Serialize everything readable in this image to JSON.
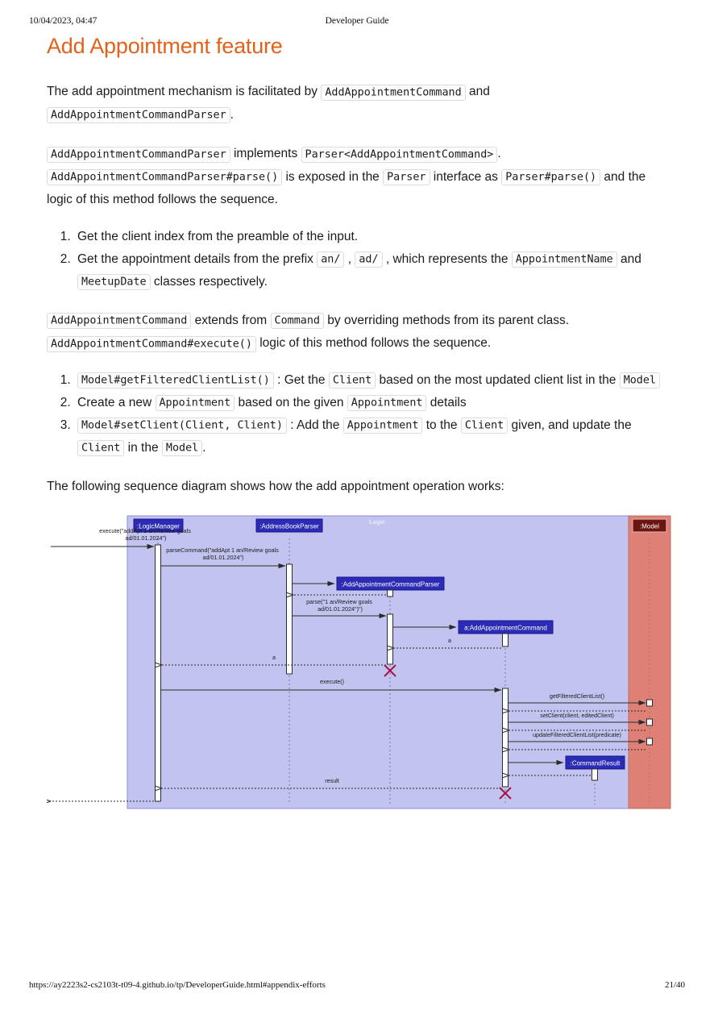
{
  "print_header": {
    "date": "10/04/2023, 04:47",
    "title": "Developer Guide"
  },
  "print_footer": {
    "url": "https://ay2223s2-cs2103t-t09-4.github.io/tp/DeveloperGuide.html#appendix-efforts",
    "page": "21/40"
  },
  "doc": {
    "title": "Add Appointment feature",
    "title_color": "#e2621b",
    "p1": {
      "t1": "The add appointment mechanism is facilitated by ",
      "c1": "AddAppointmentCommand",
      "t2": " and ",
      "c2": "AddAppointmentCommandParser",
      "t3": "."
    },
    "p2": {
      "c1": "AddAppointmentCommandParser",
      "t1": " implements ",
      "c2": "Parser<AddAppointmentCommand>",
      "t2": ". ",
      "c3": "AddAppointmentCommandParser#parse()",
      "t3": " is exposed in the ",
      "c4": "Parser",
      "t4": " interface as ",
      "c5": "Parser#parse()",
      "t5": " and the logic of this method follows the sequence."
    },
    "list1": {
      "item1": {
        "t1": "Get the client index from the preamble of the input."
      },
      "item2": {
        "t1": "Get the appointment details from the prefix ",
        "c1": "an/",
        "t2": " , ",
        "c2": "ad/",
        "t3": " , which represents the ",
        "c3": "AppointmentName",
        "t4": " and ",
        "c4": "MeetupDate",
        "t5": " classes respectively."
      }
    },
    "p3": {
      "c1": "AddAppointmentCommand",
      "t1": " extends from ",
      "c2": "Command",
      "t2": " by overriding methods from its parent class. ",
      "c3": "AddAppointmentCommand#execute()",
      "t3": " logic of this method follows the sequence."
    },
    "list2": {
      "item1": {
        "c1": "Model#getFilteredClientList()",
        "t1": " : Get the ",
        "c2": "Client",
        "t2": " based on the most updated client list in the ",
        "c3": "Model"
      },
      "item2": {
        "t1": "Create a new ",
        "c1": "Appointment",
        "t2": " based on the given ",
        "c2": "Appointment",
        "t3": " details"
      },
      "item3": {
        "c1": "Model#setClient(Client, Client)",
        "t1": " : Add the ",
        "c2": "Appointment",
        "t2": " to the ",
        "c3": "Client",
        "t3": " given, and update the ",
        "c4": "Client",
        "t4": " in the ",
        "c5": "Model",
        "t5": "."
      }
    },
    "p4": "The following sequence diagram shows how the add appointment operation works:"
  },
  "diagram": {
    "type": "uml-sequence",
    "colors": {
      "logic_panel_bg": "#c3c3f0",
      "logic_panel_border": "#8a8ad8",
      "model_panel_bg": "#df8077",
      "model_panel_border": "#c06a62",
      "participant_fill": "#2b2bb5",
      "participant_text": "#ffffff",
      "model_participant_fill": "#6b1410",
      "model_participant_border": "#d8a6a0",
      "activation_fill": "#ffffff",
      "activation_border": "#2b2b2b",
      "line": "#2b2b2b",
      "destroy_x": "#a01848",
      "group_label": "#f0f0f6"
    },
    "groups": [
      {
        "label": "Logic",
        "kind": "logic"
      },
      {
        "label": "Model",
        "kind": "model"
      }
    ],
    "participants": [
      {
        "id": "lm",
        "label": ":LogicManager",
        "group": "logic"
      },
      {
        "id": "abp",
        "label": ":AddressBookParser",
        "group": "logic"
      },
      {
        "id": "aacp",
        "label": ":AddAppointmentCommandParser",
        "group": "logic"
      },
      {
        "id": "aac",
        "label": "a:AddAppointmentCommand",
        "group": "logic"
      },
      {
        "id": "cr",
        "label": ":CommandResult",
        "group": "logic"
      },
      {
        "id": "model",
        "label": ":Model",
        "group": "model"
      }
    ],
    "messages": [
      {
        "from": "actor",
        "to": "lm",
        "label": "execute(\"addApt 1 an/Review goals\nad/01.01.2024\")",
        "kind": "call"
      },
      {
        "from": "lm",
        "to": "abp",
        "label": "parseCommand(\"addApt 1 an/Review goals\nad/01.01.2024\")",
        "kind": "call"
      },
      {
        "from": "abp",
        "to": "aacp",
        "label": "",
        "kind": "create"
      },
      {
        "from": "aacp",
        "to": "abp",
        "label": "",
        "kind": "return"
      },
      {
        "from": "abp",
        "to": "aacp",
        "label": "parse(\"1 an/Review goals\nad/01.01.2024\")\")",
        "kind": "call"
      },
      {
        "from": "aacp",
        "to": "aac",
        "label": "",
        "kind": "create"
      },
      {
        "from": "aac",
        "to": "aacp",
        "label": "a",
        "kind": "return"
      },
      {
        "from": "aacp",
        "to": "lm",
        "label": "a",
        "kind": "return"
      },
      {
        "from": "destroy",
        "to": "aacp",
        "label": "",
        "kind": "destroy"
      },
      {
        "from": "lm",
        "to": "aac",
        "label": "execute()",
        "kind": "call"
      },
      {
        "from": "aac",
        "to": "model",
        "label": "getFilteredClientList()",
        "kind": "call"
      },
      {
        "from": "model",
        "to": "aac",
        "label": "",
        "kind": "return"
      },
      {
        "from": "aac",
        "to": "model",
        "label": "setClient(client, editedClient)",
        "kind": "call"
      },
      {
        "from": "model",
        "to": "aac",
        "label": "",
        "kind": "return"
      },
      {
        "from": "aac",
        "to": "model",
        "label": "updateFilteredClientList(predicate)",
        "kind": "call"
      },
      {
        "from": "model",
        "to": "aac",
        "label": "",
        "kind": "return"
      },
      {
        "from": "aac",
        "to": "cr",
        "label": "",
        "kind": "create"
      },
      {
        "from": "cr",
        "to": "aac",
        "label": "",
        "kind": "return"
      },
      {
        "from": "aac",
        "to": "lm",
        "label": "result",
        "kind": "return"
      },
      {
        "from": "destroy",
        "to": "aac",
        "label": "",
        "kind": "destroy"
      },
      {
        "from": "lm",
        "to": "actor",
        "label": "",
        "kind": "return"
      }
    ]
  }
}
